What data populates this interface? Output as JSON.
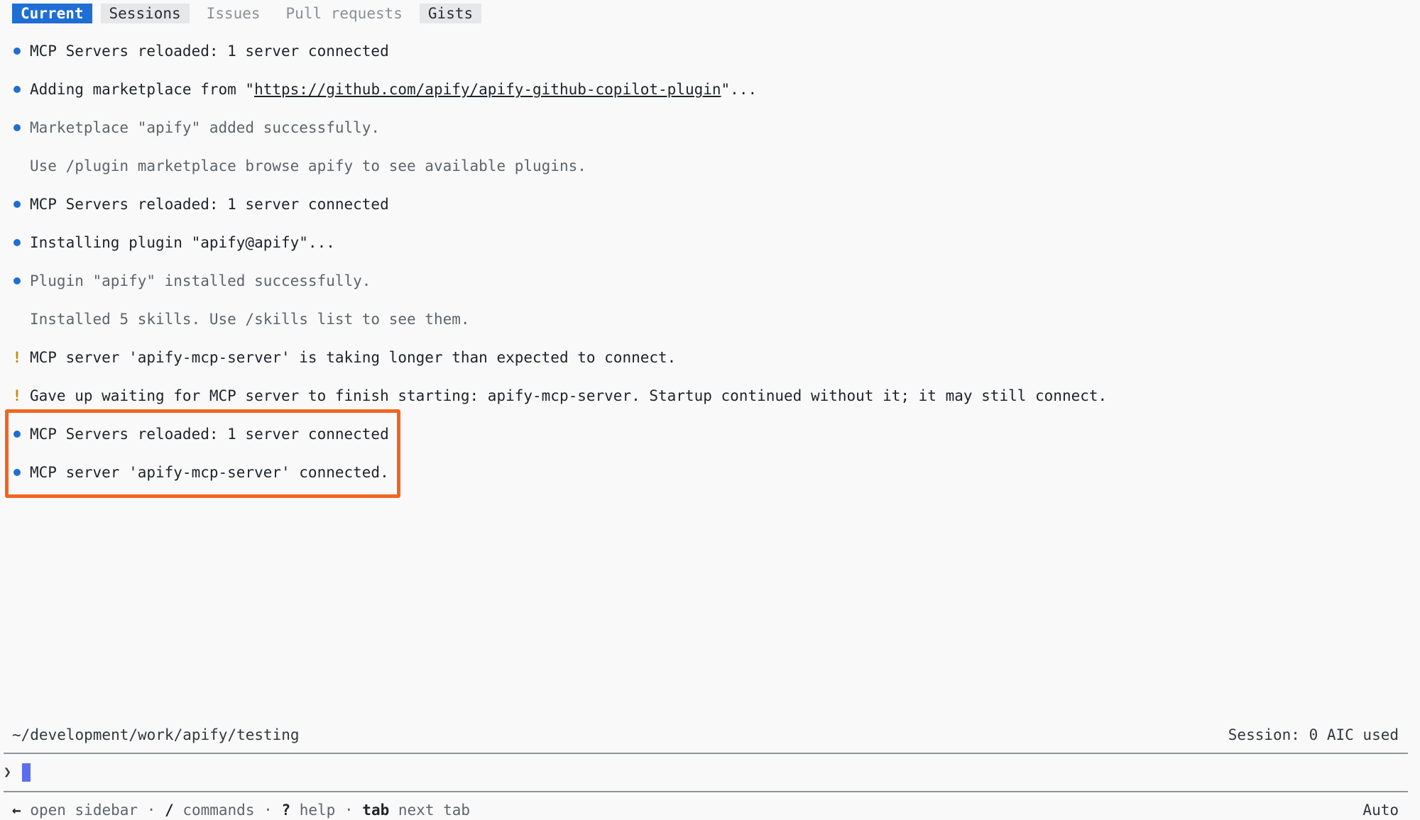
{
  "tabs": [
    {
      "label": "Current",
      "state": "active"
    },
    {
      "label": "Sessions",
      "state": "muted-bg"
    },
    {
      "label": "Issues",
      "state": "plain"
    },
    {
      "label": "Pull requests",
      "state": "plain"
    },
    {
      "label": "Gists",
      "state": "muted-bg"
    }
  ],
  "log": [
    {
      "marker": "dot",
      "text": "MCP Servers reloaded: 1 server connected"
    },
    {
      "marker": "dot",
      "prefix": "Adding marketplace from \"",
      "link": "https://github.com/apify/apify-github-copilot-plugin",
      "suffix": "\"..."
    },
    {
      "marker": "dot",
      "text": "Marketplace \"apify\" added successfully.",
      "muted": true
    },
    {
      "marker": "none",
      "text": "Use /plugin marketplace browse apify to see available plugins.",
      "muted": true
    },
    {
      "marker": "dot",
      "text": "MCP Servers reloaded: 1 server connected"
    },
    {
      "marker": "dot",
      "text": "Installing plugin \"apify@apify\"..."
    },
    {
      "marker": "dot",
      "text": "Plugin \"apify\" installed successfully.",
      "muted": true
    },
    {
      "marker": "none",
      "text": "Installed 5 skills. Use /skills list to see them.",
      "muted": true
    },
    {
      "marker": "warn",
      "text": "MCP server 'apify-mcp-server' is taking longer than expected to connect."
    },
    {
      "marker": "warn",
      "text": "Gave up waiting for MCP server to finish starting: apify-mcp-server. Startup continued without it; it may still connect."
    },
    {
      "marker": "dot",
      "text": "MCP Servers reloaded: 1 server connected"
    },
    {
      "marker": "dot",
      "text": "MCP server 'apify-mcp-server' connected."
    }
  ],
  "markers": {
    "warn": "!"
  },
  "status": {
    "path": "~/development/work/apify/testing",
    "session": "Session: 0 AIC used"
  },
  "prompt": {
    "caret": "❯",
    "value": ""
  },
  "footer": {
    "arrow": "←",
    "open_sidebar": "open sidebar",
    "sep": "·",
    "slash": "/",
    "commands": "commands",
    "question": "?",
    "help": "help",
    "tab_key": "tab",
    "next_tab": "next tab",
    "mode": "Auto"
  },
  "colors": {
    "accent": "#1f6ed4",
    "warning": "#c98a0a",
    "highlight_border": "#f0661f",
    "cursor": "#5b6ef0"
  }
}
